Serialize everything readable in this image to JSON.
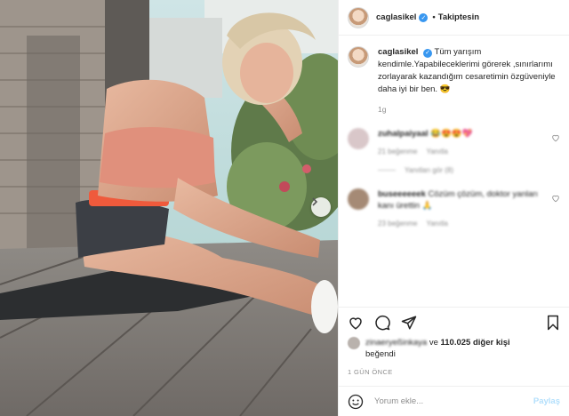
{
  "post": {
    "username": "caglasikel",
    "follow_label": "Takiptesin",
    "follow_separator": "•",
    "caption": "Tüm yarışım kendimle.Yapabileceklerimi görerek ,sınırlarımı zorlayarak kazandığım cesaretimin özgüveniyle daha iyi bir ben.",
    "caption_emoji": "😎",
    "caption_age": "1g"
  },
  "comments": [
    {
      "username": "zuhalpaiyaal",
      "text": "😂😍😍💖",
      "likes": "21 beğenme",
      "reply_label": "Yanıtla",
      "replies": "Yanıtları gör (8)",
      "avatar_color": "#d9c7c9"
    },
    {
      "username": "buseeeeeek",
      "text": "Cözüm çözüm, doktor yanları kanı ürettin 🙏",
      "likes": "23 beğenme",
      "reply_label": "Yanıtla",
      "avatar_color": "#a58a75"
    }
  ],
  "likes": {
    "liker": "zinaeryeßinkaya",
    "connector": "ve",
    "count": "110.025 diğer kişi",
    "suffix": "beğendi"
  },
  "date_label": "1 GÜN ÖNCE",
  "add_comment": {
    "placeholder": "Yorum ekle...",
    "post_label": "Paylaş"
  },
  "icons": {
    "verified": "verified-check-icon",
    "heart": "heart-icon",
    "comment": "comment-bubble-icon",
    "share": "paper-plane-icon",
    "bookmark": "bookmark-icon",
    "emoji": "smiley-icon",
    "next": "chevron-right-icon"
  },
  "colors": {
    "verified_blue": "#3897f0",
    "post_button": "#b2dffc",
    "muted_text": "#8e8e8e",
    "border": "#efefef"
  }
}
